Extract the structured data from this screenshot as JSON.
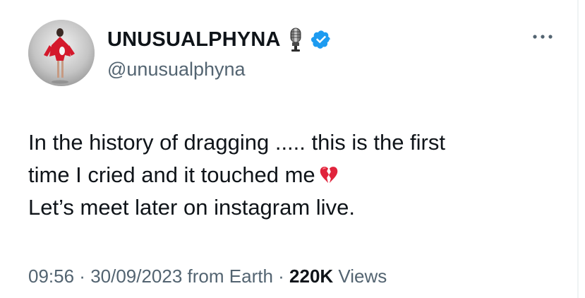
{
  "author": {
    "display_name": "UNUSUALPHYNA",
    "handle": "@unusualphyna",
    "avatar_icon": "avatar-photo",
    "badges": [
      "microphone-icon",
      "verified-badge-icon"
    ],
    "verified_color": "#1d9bf0"
  },
  "tweet": {
    "lines": [
      "In the history of dragging ..... this is the first",
      "time I cried and it touched me",
      "Let’s meet later on instagram live."
    ],
    "emoji": "broken-heart-icon"
  },
  "meta": {
    "time": "09:56",
    "separator_1": " · ",
    "date": "30/09/2023",
    "source": " from Earth",
    "separator_2": " · ",
    "views_count": "220K",
    "views_label": " Views"
  },
  "colors": {
    "text": "#0f1419",
    "secondary": "#536471",
    "accent": "#1d9bf0",
    "heart": "#e0243c"
  }
}
